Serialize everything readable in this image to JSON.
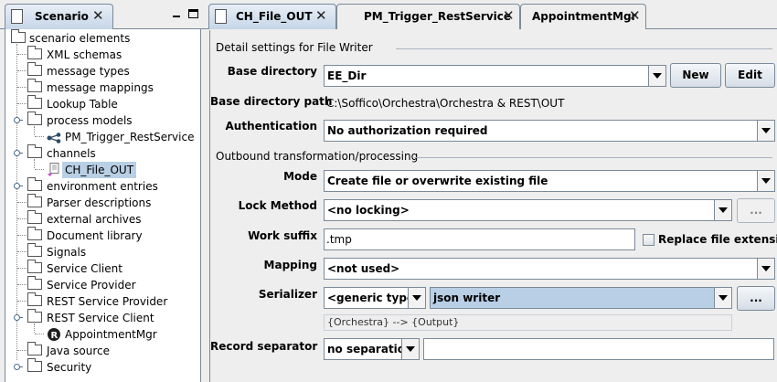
{
  "left_panel": {
    "tab": {
      "label": "Scenario"
    },
    "tree": {
      "root": "scenario elements",
      "items": [
        {
          "label": "XML schemas"
        },
        {
          "label": "message types"
        },
        {
          "label": "message mappings"
        },
        {
          "label": "Lookup Table"
        },
        {
          "label": "process models"
        },
        {
          "label": "PM_Trigger_RestService"
        },
        {
          "label": "channels"
        },
        {
          "label": "CH_File_OUT"
        },
        {
          "label": "environment entries"
        },
        {
          "label": "Parser descriptions"
        },
        {
          "label": "external archives"
        },
        {
          "label": "Document library"
        },
        {
          "label": "Signals"
        },
        {
          "label": "Service Client"
        },
        {
          "label": "Service Provider"
        },
        {
          "label": "REST Service Provider"
        },
        {
          "label": "REST Service Client"
        },
        {
          "label": "AppointmentMgr"
        },
        {
          "label": "Java source"
        },
        {
          "label": "Security"
        }
      ]
    }
  },
  "editor_tabs": [
    {
      "label": "CH_File_OUT",
      "active": true
    },
    {
      "label": "PM_Trigger_RestService",
      "active": false
    },
    {
      "label": "AppointmentMgr",
      "active": false
    }
  ],
  "form": {
    "section1_title": "Detail settings for File Writer",
    "base_directory": {
      "label": "Base directory",
      "value": "EE_Dir",
      "new_label": "New",
      "edit_label": "Edit"
    },
    "base_directory_path": {
      "label": "Base directory path",
      "value": "C:\\Soffico\\Orchestra\\Orchestra & REST\\OUT"
    },
    "authentication": {
      "label": "Authentication",
      "value": "No authorization required"
    },
    "section2_title": "Outbound transformation/processing",
    "mode": {
      "label": "Mode",
      "value": "Create file or overwrite existing file"
    },
    "lock_method": {
      "label": "Lock Method",
      "value": "<no locking>",
      "more_label": "..."
    },
    "work_suffix": {
      "label": "Work suffix",
      "value": ".tmp",
      "replace_label": "Replace file extension"
    },
    "mapping": {
      "label": "Mapping",
      "value": "<not used>"
    },
    "serializer": {
      "label": "Serializer",
      "type_value": "<generic type>",
      "value": "json writer",
      "more_label": "...",
      "info": "{Orchestra} --> {Output}"
    },
    "record_separator": {
      "label": "Record separator",
      "value": "no separation",
      "text": ""
    }
  }
}
